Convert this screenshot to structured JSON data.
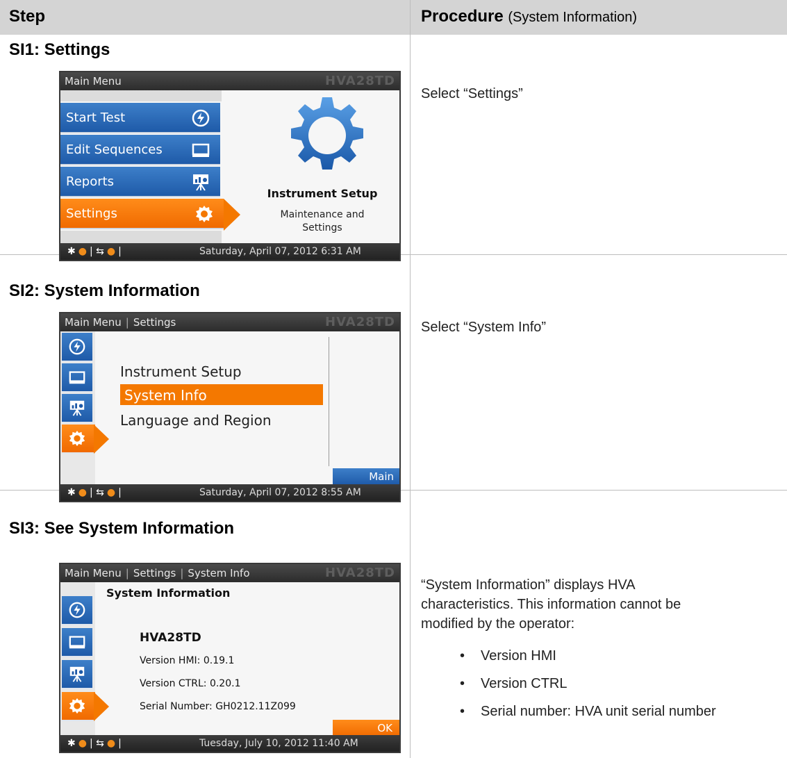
{
  "header": {
    "step": "Step",
    "procedure": "Procedure",
    "procedure_sub": "(System Information)"
  },
  "rows": [
    {
      "title": "SI1: Settings",
      "procedure": "Select “Settings”",
      "screen": {
        "titlebar": "Main Menu",
        "brand": "HVA28TD",
        "menu": [
          "Start Test",
          "Edit Sequences",
          "Reports",
          "Settings"
        ],
        "panel_title": "Instrument Setup",
        "panel_sub": [
          "Maintenance and",
          "Settings"
        ],
        "date": "Saturday, April 07, 2012 6:31 AM"
      }
    },
    {
      "title": "SI2: System Information",
      "procedure": "Select “System Info”",
      "screen": {
        "crumb_main": "Main Menu",
        "crumb_settings": "Settings",
        "brand": "HVA28TD",
        "items": [
          "Instrument Setup",
          "System Info",
          "Language and Region"
        ],
        "main_button": "Main",
        "date": "Saturday, April 07, 2012 8:55 AM"
      }
    },
    {
      "title": "SI3: See System Information",
      "procedure_lines": [
        "“System Information” displays HVA",
        "characteristics. This information cannot be",
        "modified by the operator:"
      ],
      "bullets": [
        "Version HMI",
        "Version CTRL",
        "Serial number: HVA unit serial number"
      ],
      "screen": {
        "crumb_main": "Main Menu",
        "crumb_settings": "Settings",
        "crumb_info": "System Info",
        "brand": "HVA28TD",
        "heading": "System Information",
        "model": "HVA28TD",
        "version_hmi": "Version HMI: 0.19.1",
        "version_ctrl": "Version CTRL: 0.20.1",
        "serial": "Serial Number: GH0212.11Z099",
        "ok_button": "OK",
        "date": "Tuesday, July 10, 2012 11:40 AM"
      }
    }
  ],
  "colors": {
    "orange": "#f47800",
    "blue": "#1e5aa8",
    "header_gray": "#d4d4d4"
  },
  "icons": [
    "lightning-icon",
    "monitor-icon",
    "presentation-chart-icon",
    "gear-icon",
    "bluetooth-icon",
    "usb-icon"
  ]
}
